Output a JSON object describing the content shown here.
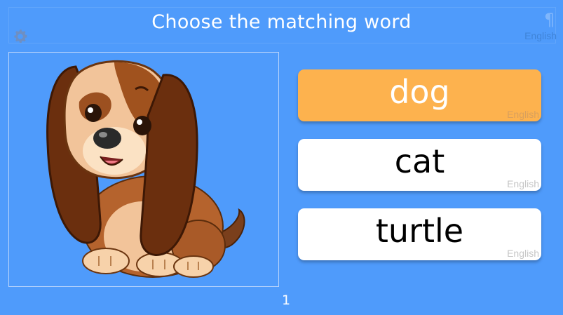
{
  "header": {
    "title": "Choose the matching word",
    "language": "English",
    "settings_icon": "gear-icon",
    "pilcrow_icon": "¶"
  },
  "options": [
    {
      "word": "dog",
      "language": "English",
      "selected": true
    },
    {
      "word": "cat",
      "language": "English",
      "selected": false
    },
    {
      "word": "turtle",
      "language": "English",
      "selected": false
    }
  ],
  "footer": {
    "page": "1"
  },
  "colors": {
    "background": "#4f9bfb",
    "selected": "#fdb24e",
    "option": "#ffffff"
  }
}
